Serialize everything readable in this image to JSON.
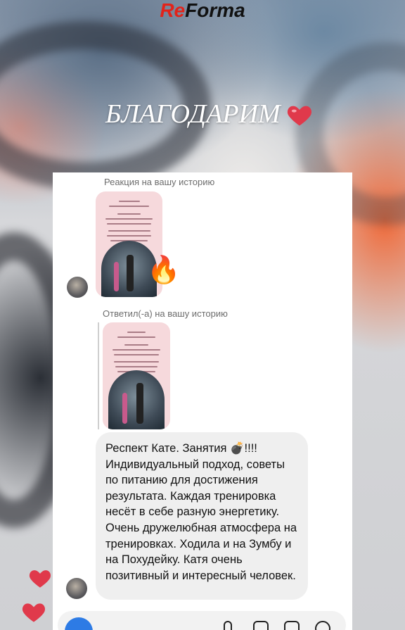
{
  "brand": {
    "logo_re": "Re",
    "logo_rest": "Forma"
  },
  "headline": {
    "text": "БЛАГОДАРИМ"
  },
  "chat": {
    "reaction_label": "Реакция на вашу историю",
    "reply_label": "Ответил(-а) на вашу историю",
    "reaction_emoji": "🔥",
    "message": "Респект Кате. Занятия 💣!!!! Индивидуальный подход, советы по питанию для достижения результата. Каждая тренировка несёт в себе разную энергетику. Очень дружелюбная атмосфера на тренировках. Ходила и на Зумбу и на Похудейку. Катя очень позитивный и интересный человек."
  },
  "colors": {
    "accent_red": "#e2231a",
    "heart": "#e0394b",
    "bubble": "#efefef",
    "story_pink": "#f6d9dc"
  },
  "icons": {
    "headline_heart": "heart-icon",
    "side_hearts": "heart-icon",
    "camera": "camera-icon",
    "mic": "mic-icon",
    "gallery": "gallery-icon",
    "sticker": "sticker-icon"
  }
}
